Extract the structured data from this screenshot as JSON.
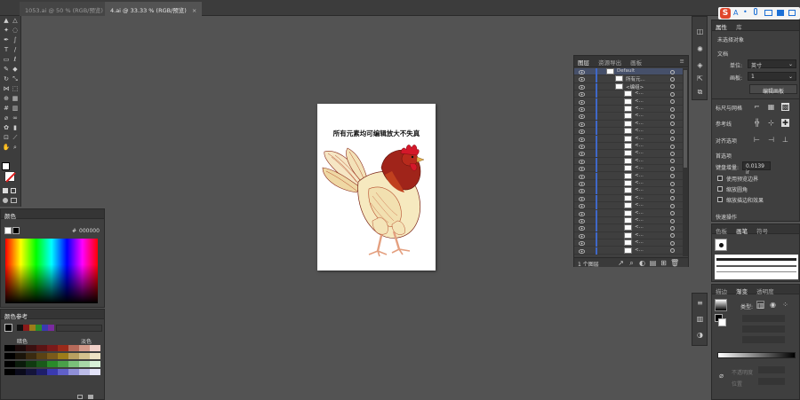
{
  "tabs": [
    {
      "label": "1053.ai @ 50 % (RGB/预览)",
      "active": false
    },
    {
      "label": "4.ai @ 33.33 % (RGB/预览)",
      "active": true
    }
  ],
  "close_glyph": "×",
  "artboard": {
    "title": "所有元素均可编辑放大不失真"
  },
  "color_panel": {
    "tab": "颜色",
    "hex_label": "#",
    "hex_value": "000000"
  },
  "color_guide": {
    "tab": "颜色参考",
    "dark_label": "暗色",
    "light_label": "淡色"
  },
  "layers_panel": {
    "tabs": [
      "图层",
      "资源导出",
      "画板"
    ],
    "rows": [
      {
        "name": "Default",
        "indent": 0
      },
      {
        "name": "所有元...",
        "indent": 1
      },
      {
        "name": "<编组>",
        "indent": 1
      },
      {
        "name": "<...",
        "indent": 2
      },
      {
        "name": "<...",
        "indent": 2
      },
      {
        "name": "<...",
        "indent": 2
      },
      {
        "name": "<...",
        "indent": 2
      },
      {
        "name": "<...",
        "indent": 2
      },
      {
        "name": "<...",
        "indent": 2
      },
      {
        "name": "<...",
        "indent": 2
      },
      {
        "name": "<...",
        "indent": 2
      },
      {
        "name": "<...",
        "indent": 2
      },
      {
        "name": "<...",
        "indent": 2
      },
      {
        "name": "<...",
        "indent": 2
      },
      {
        "name": "<...",
        "indent": 2
      },
      {
        "name": "<...",
        "indent": 2
      },
      {
        "name": "<...",
        "indent": 2
      },
      {
        "name": "<...",
        "indent": 2
      },
      {
        "name": "<...",
        "indent": 2
      },
      {
        "name": "<...",
        "indent": 2
      },
      {
        "name": "<...",
        "indent": 2
      },
      {
        "name": "<...",
        "indent": 2
      },
      {
        "name": "<...",
        "indent": 2
      },
      {
        "name": "<...",
        "indent": 2
      },
      {
        "name": "<...",
        "indent": 2
      }
    ],
    "footer": "1 个图层"
  },
  "properties_panel": {
    "tabs": [
      "属性",
      "库"
    ],
    "no_selection": "未选择对象",
    "document_label": "文档",
    "unit_label": "单位:",
    "unit_value": "英寸",
    "artboard_label": "画板:",
    "artboard_value": "1",
    "edit_artboard_button": "编辑画板",
    "rulers_grid": "标尺与网格",
    "guides": "参考线",
    "snap": "对齐选项",
    "preferences": "首选项",
    "keyboard_increment_label": "键盘增量:",
    "keyboard_increment_value": "0.0139 ir",
    "use_preview_bounds": "使用预览边界",
    "scale_corners": "缩放圆角",
    "scale_strokes": "缩放描边和效果",
    "quick_actions": "快速操作"
  },
  "brushes_panel": {
    "tabs": [
      "色板",
      "画笔",
      "符号"
    ]
  },
  "gradient_panel": {
    "tabs": [
      "描边",
      "渐变",
      "透明度"
    ],
    "type_label": "类型:",
    "opacity_label": "不透明度",
    "position_label": "位置"
  },
  "ime": {
    "logo": "S",
    "items": [
      "A",
      "•",
      "🎤",
      "⌨",
      "👕",
      "☷"
    ]
  },
  "colors": {
    "accent_blue": "#3f68c8",
    "rooster_red": "#a0241a",
    "rooster_comb": "#d4182a"
  }
}
